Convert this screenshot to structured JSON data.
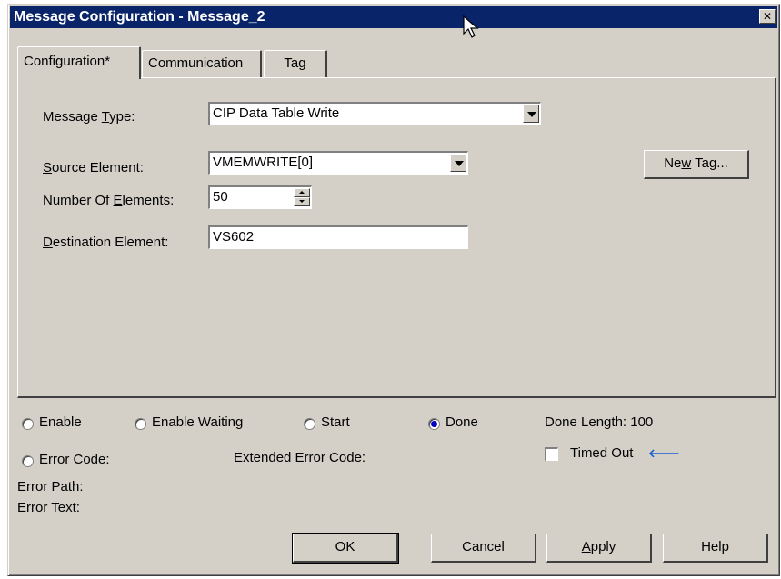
{
  "window": {
    "title": "Message Configuration - Message_2",
    "close_label": "✕"
  },
  "tabs": [
    {
      "label": "Configuration*"
    },
    {
      "label": "Communication"
    },
    {
      "label": "Tag"
    }
  ],
  "config": {
    "message_type_label_pre": "Message ",
    "message_type_label_ul": "T",
    "message_type_label_post": "ype:",
    "message_type_value": "CIP Data Table Write",
    "source_label_ul": "S",
    "source_label_post": "ource Element:",
    "source_value": "VMEMWRITE[0]",
    "num_label_pre": "Number Of ",
    "num_label_ul": "E",
    "num_label_post": "lements:",
    "num_value": "50",
    "dest_label_ul": "D",
    "dest_label_post": "estination Element:",
    "dest_value": "VS602",
    "new_tag_pre": "Ne",
    "new_tag_ul": "w",
    "new_tag_post": " Tag..."
  },
  "status": {
    "enable": "Enable",
    "enable_waiting": "Enable Waiting",
    "start": "Start",
    "done": "Done",
    "done_length": "Done Length: 100",
    "error_code": "Error Code:",
    "extended_error_code": "Extended Error Code:",
    "timed_out": "Timed Out",
    "timed_out_arrow": "🡐",
    "error_path": "Error Path:",
    "error_text": "Error Text:",
    "done_selected": true
  },
  "buttons": {
    "ok": "OK",
    "cancel": "Cancel",
    "apply_ul": "A",
    "apply_post": "pply",
    "help": "Help"
  }
}
